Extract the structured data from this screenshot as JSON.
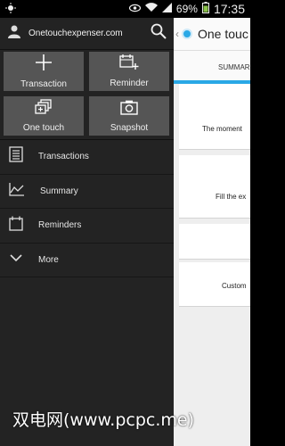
{
  "status_bar": {
    "battery": "69%",
    "time": "17:35",
    "icons": [
      "weather-icon",
      "eye-icon",
      "wifi-icon",
      "signal-icon",
      "battery-icon"
    ]
  },
  "drawer": {
    "account_email": "Onetouchexpenser.com",
    "tiles": [
      {
        "label": "Transaction",
        "icon": "plus-icon"
      },
      {
        "label": "Reminder",
        "icon": "reminder-add-icon"
      },
      {
        "label": "One touch",
        "icon": "one-touch-icon"
      },
      {
        "label": "Snapshot",
        "icon": "camera-icon"
      }
    ],
    "menu": [
      {
        "label": "Transactions",
        "icon": "list-icon"
      },
      {
        "label": "Summary",
        "icon": "chart-line-icon"
      },
      {
        "label": "Reminders",
        "icon": "calendar-icon"
      },
      {
        "label": "More",
        "icon": "chevron-down-icon"
      }
    ]
  },
  "main": {
    "title": "One touc",
    "tab_label": "SUMMAR",
    "cards": [
      {
        "text": "The moment"
      },
      {
        "text": "Fill the ex"
      },
      {
        "text": ""
      },
      {
        "text": "Custom"
      }
    ]
  },
  "watermark": "双电网(www.pcpc.me)",
  "colors": {
    "accent": "#29a8e6",
    "drawer_bg": "#232323",
    "tile_bg": "#555555"
  }
}
